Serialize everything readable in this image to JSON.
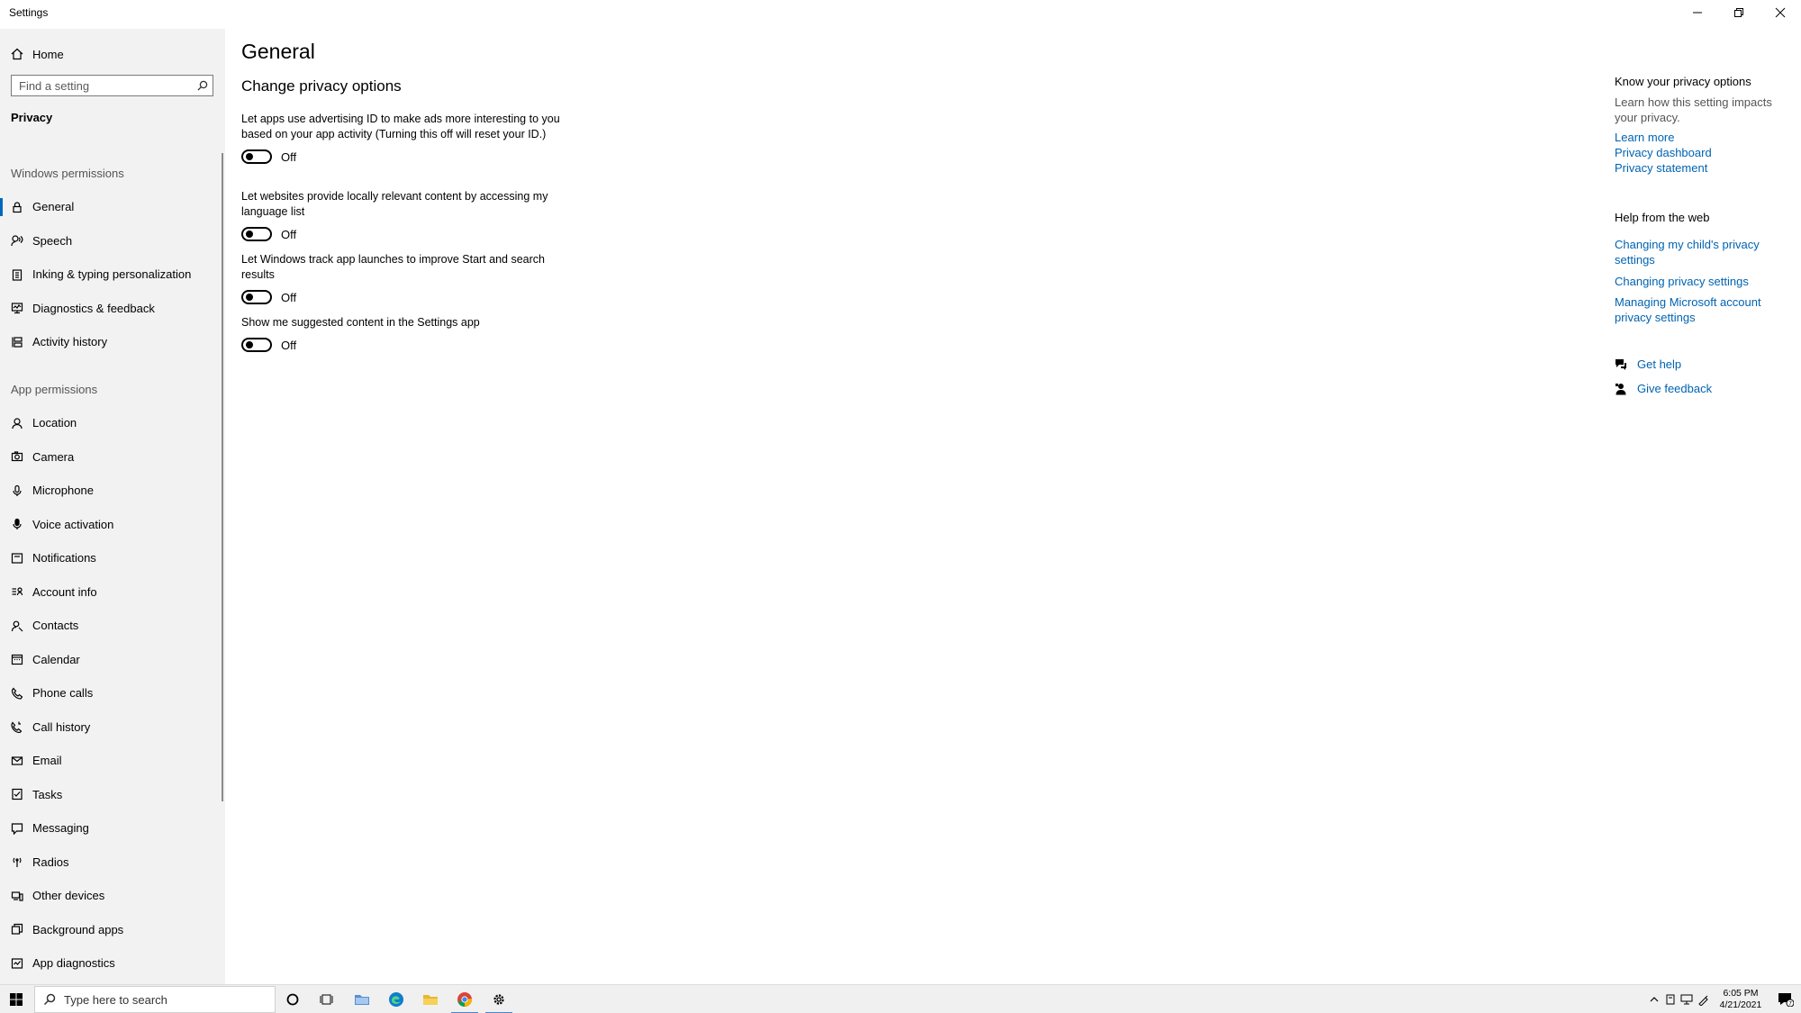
{
  "window": {
    "title": "Settings"
  },
  "sidebar": {
    "home_label": "Home",
    "search_placeholder": "Find a setting",
    "section_heading": "Privacy",
    "windows_permissions_label": "Windows permissions",
    "windows_permissions": [
      {
        "label": "General",
        "icon": "lock-icon",
        "active": true
      },
      {
        "label": "Speech",
        "icon": "speech-icon"
      },
      {
        "label": "Inking & typing personalization",
        "icon": "clipboard-icon"
      },
      {
        "label": "Diagnostics & feedback",
        "icon": "diagnostics-icon"
      },
      {
        "label": "Activity history",
        "icon": "timeline-icon"
      }
    ],
    "app_permissions_label": "App permissions",
    "app_permissions": [
      {
        "label": "Location",
        "icon": "location-icon"
      },
      {
        "label": "Camera",
        "icon": "camera-icon"
      },
      {
        "label": "Microphone",
        "icon": "microphone-icon"
      },
      {
        "label": "Voice activation",
        "icon": "voice-activation-icon"
      },
      {
        "label": "Notifications",
        "icon": "notifications-icon"
      },
      {
        "label": "Account info",
        "icon": "account-info-icon"
      },
      {
        "label": "Contacts",
        "icon": "contacts-icon"
      },
      {
        "label": "Calendar",
        "icon": "calendar-icon"
      },
      {
        "label": "Phone calls",
        "icon": "phone-icon"
      },
      {
        "label": "Call history",
        "icon": "call-history-icon"
      },
      {
        "label": "Email",
        "icon": "email-icon"
      },
      {
        "label": "Tasks",
        "icon": "tasks-icon"
      },
      {
        "label": "Messaging",
        "icon": "messaging-icon"
      },
      {
        "label": "Radios",
        "icon": "radios-icon"
      },
      {
        "label": "Other devices",
        "icon": "devices-icon"
      },
      {
        "label": "Background apps",
        "icon": "background-apps-icon"
      },
      {
        "label": "App diagnostics",
        "icon": "app-diagnostics-icon"
      }
    ]
  },
  "main": {
    "title": "General",
    "section_title": "Change privacy options",
    "settings": [
      {
        "description": "Let apps use advertising ID to make ads more interesting to you based on your app activity (Turning this off will reset your ID.)",
        "state": "Off"
      },
      {
        "description": "Let websites provide locally relevant content by accessing my language list",
        "state": "Off"
      },
      {
        "description": "Let Windows track app launches to improve Start and search results",
        "state": "Off"
      },
      {
        "description": "Show me suggested content in the Settings app",
        "state": "Off"
      }
    ]
  },
  "right_pane": {
    "know_heading": "Know your privacy options",
    "know_text": "Learn how this setting impacts your privacy.",
    "know_links": [
      "Learn more",
      "Privacy dashboard",
      "Privacy statement"
    ],
    "web_heading": "Help from the web",
    "web_links": [
      "Changing my child's privacy settings",
      "Changing privacy settings",
      "Managing Microsoft account privacy settings"
    ],
    "get_help": "Get help",
    "give_feedback": "Give feedback"
  },
  "taskbar": {
    "search_placeholder": "Type here to search",
    "time": "6:05 PM",
    "date": "4/21/2021",
    "notification_count": "7"
  },
  "colors": {
    "accent": "#0067c0",
    "link": "#0063b1",
    "sidebar_bg": "#f2f2f2"
  }
}
